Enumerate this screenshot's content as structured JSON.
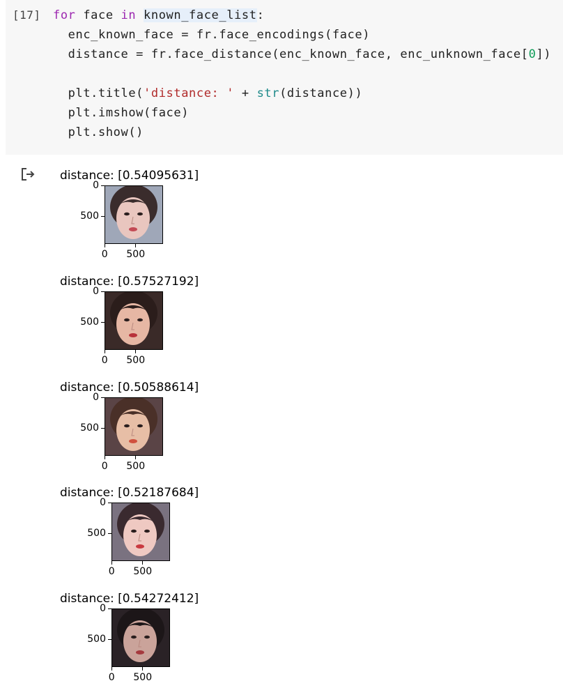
{
  "cell": {
    "exec_count": "[17]",
    "lines": [
      {
        "indent": "",
        "tokens": [
          {
            "t": "for",
            "c": "kw"
          },
          {
            "t": " face ",
            "c": ""
          },
          {
            "t": "in",
            "c": "kw"
          },
          {
            "t": " ",
            "c": ""
          },
          {
            "t": "known_face_list",
            "c": "hl"
          },
          {
            "t": ":",
            "c": ""
          }
        ]
      },
      {
        "indent": "  ",
        "tokens": [
          {
            "t": "enc_known_face = fr.face_encodings(face)",
            "c": ""
          }
        ]
      },
      {
        "indent": "  ",
        "tokens": [
          {
            "t": "distance = fr.face_distance(enc_known_face, enc_unknown_face[",
            "c": ""
          },
          {
            "t": "0",
            "c": "num"
          },
          {
            "t": "])",
            "c": ""
          }
        ]
      },
      {
        "indent": "",
        "tokens": [
          {
            "t": "",
            "c": ""
          }
        ]
      },
      {
        "indent": "  ",
        "tokens": [
          {
            "t": "plt.title(",
            "c": ""
          },
          {
            "t": "'distance: '",
            "c": "str"
          },
          {
            "t": " + ",
            "c": ""
          },
          {
            "t": "str",
            "c": "fn"
          },
          {
            "t": "(distance))",
            "c": ""
          }
        ]
      },
      {
        "indent": "  ",
        "tokens": [
          {
            "t": "plt.imshow(face)",
            "c": ""
          }
        ]
      },
      {
        "indent": "  ",
        "tokens": [
          {
            "t": "plt.show()",
            "c": ""
          }
        ]
      }
    ]
  },
  "output_icon": "output-arrow-icon",
  "figures": [
    {
      "title": "distance: [0.54095631]",
      "yticks": [
        "0",
        "500"
      ],
      "xticks": [
        "0",
        "500"
      ],
      "xtick_offset": 0,
      "skin": "#e9c6bf",
      "hair": "#3a2c2c",
      "bg": "#9fa7b8",
      "lips": "#c34a55"
    },
    {
      "title": "distance: [0.57527192]",
      "yticks": [
        "0",
        "500"
      ],
      "xticks": [
        "0",
        "500"
      ],
      "xtick_offset": 0,
      "skin": "#e6b7a4",
      "hair": "#2b1d1b",
      "bg": "#3a2a28",
      "lips": "#b8323a"
    },
    {
      "title": "distance: [0.50588614]",
      "yticks": [
        "0",
        "500"
      ],
      "xticks": [
        "0",
        "500"
      ],
      "xtick_offset": 0,
      "skin": "#e7bea6",
      "hair": "#4a3028",
      "bg": "#5a4446",
      "lips": "#d0503e"
    },
    {
      "title": "distance: [0.52187684]",
      "yticks": [
        "0",
        "500"
      ],
      "xticks": [
        "0",
        "500"
      ],
      "xtick_offset": 10,
      "skin": "#efc9c2",
      "hair": "#3a2a2f",
      "bg": "#7a7280",
      "lips": "#c93a40"
    },
    {
      "title": "distance: [0.54272412]",
      "yticks": [
        "0",
        "500"
      ],
      "xticks": [
        "0",
        "500"
      ],
      "xtick_offset": 10,
      "skin": "#caa39a",
      "hair": "#1c1618",
      "bg": "#2a2226",
      "lips": "#a53a3e"
    }
  ]
}
